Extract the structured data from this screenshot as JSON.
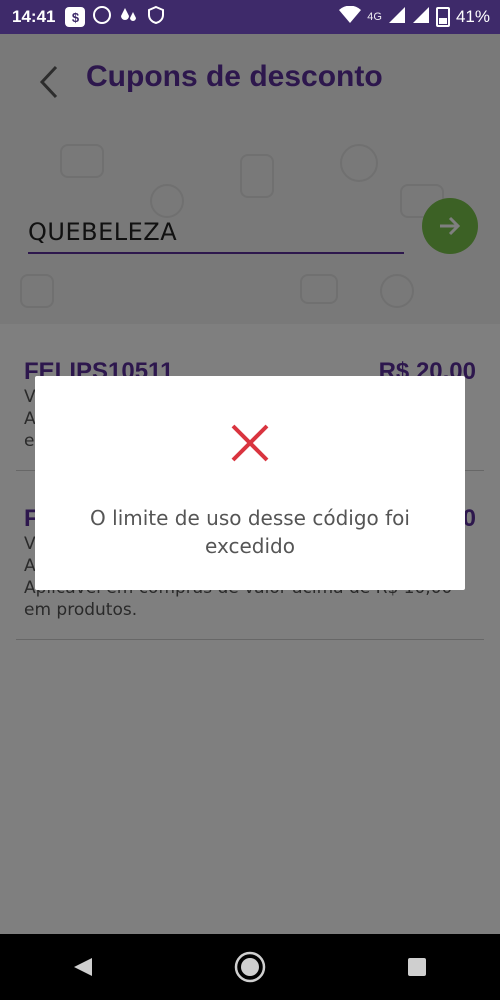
{
  "status_bar": {
    "time": "14:41",
    "network": "4G",
    "battery": "41%"
  },
  "header": {
    "title": "Cupons de desconto"
  },
  "search": {
    "value": "QUEBELEZA"
  },
  "coupons": [
    {
      "code": "FELIPS10511",
      "value": "R$ 20,00",
      "line1": "V",
      "line2": "A",
      "line3": "e"
    },
    {
      "code": "F",
      "value": "0",
      "line1": "V",
      "line2": "A",
      "line3": "Aplicável em compras de valor acima de R$ 10,00",
      "line4": "em produtos."
    }
  ],
  "dialog": {
    "message": "O limite de uso desse código foi excedido"
  },
  "colors": {
    "brand": "#5b2f9a",
    "accent_green": "#79c24a",
    "error_red": "#d9343f"
  }
}
